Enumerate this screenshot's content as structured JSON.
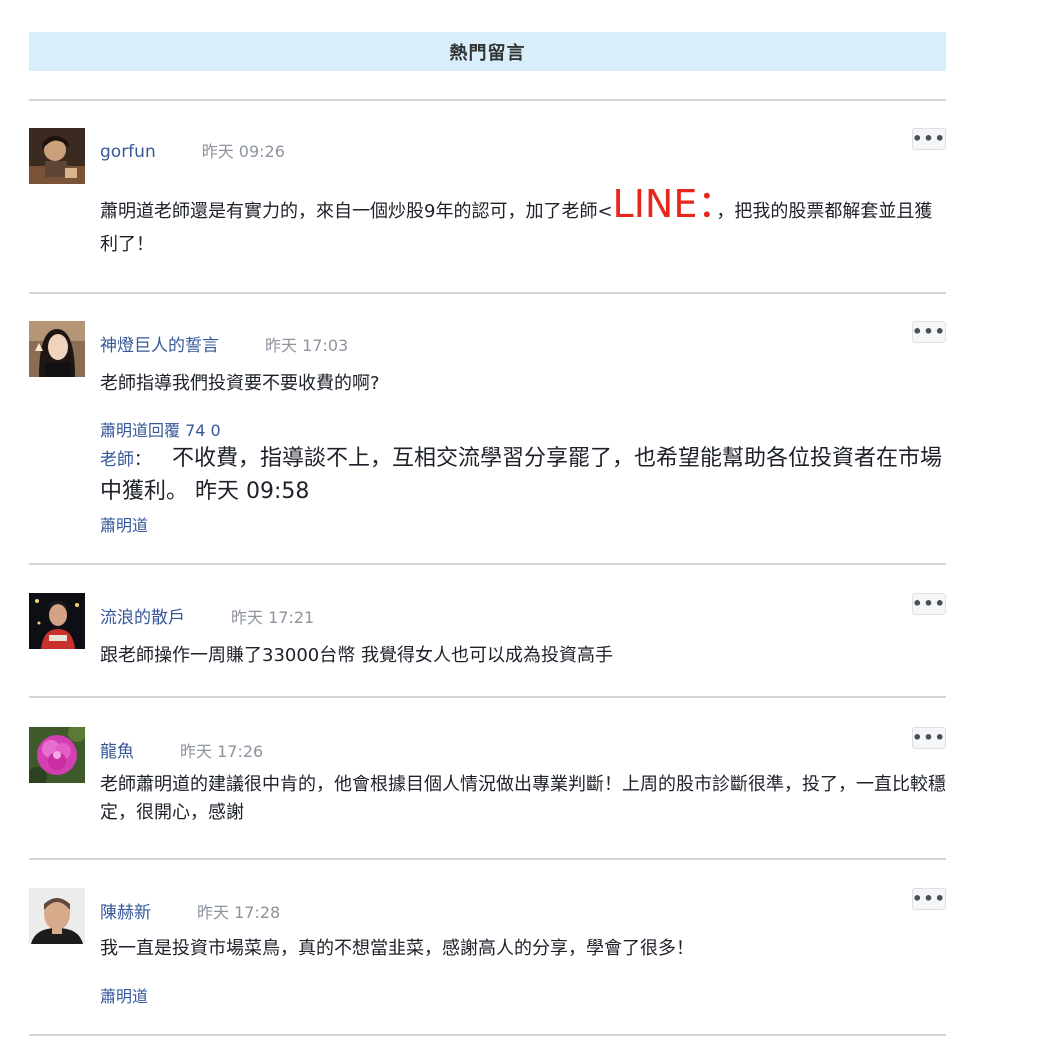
{
  "header": {
    "title": "熱門留言"
  },
  "comments": [
    {
      "name": "gorfun",
      "time": "昨天 09:26",
      "text_before": "蕭明道老師還是有實力的，來自一個炒股9年的認可，加了老師<",
      "text_highlight": "LINE：",
      "text_after": "，把我的股票都解套並且獲利了！",
      "more": "•••"
    },
    {
      "name": "神燈巨人的誓言",
      "time": "昨天 17:03",
      "text": "老師指導我們投資要不要收費的啊?",
      "reply_summary": "蕭明道回覆 74 0",
      "reply_author": "老師",
      "reply_sep": "：",
      "reply_text": "不收費，指導談不上，互相交流學習分享罷了，也希望能幫助各位投資者在市場中獲利。 昨天 09:58",
      "reply_footer": "蕭明道",
      "more": "•••"
    },
    {
      "name": "流浪的散戶",
      "time": "昨天 17:21",
      "text": "跟老師操作一周賺了33000台幣 我覺得女人也可以成為投資高手",
      "more": "•••"
    },
    {
      "name": "龍魚",
      "time": "昨天 17:26",
      "text": "老師蕭明道的建議很中肯的，他會根據目個人情況做出專業判斷！上周的股市診斷很準，投了，一直比較穩定，很開心，感謝",
      "more": "•••"
    },
    {
      "name": "陳赫新",
      "time": "昨天 17:28",
      "text": "我一直是投資市場菜鳥，真的不想當韭菜，感謝高人的分享，學會了很多！",
      "footer": "蕭明道",
      "more": "•••"
    }
  ]
}
